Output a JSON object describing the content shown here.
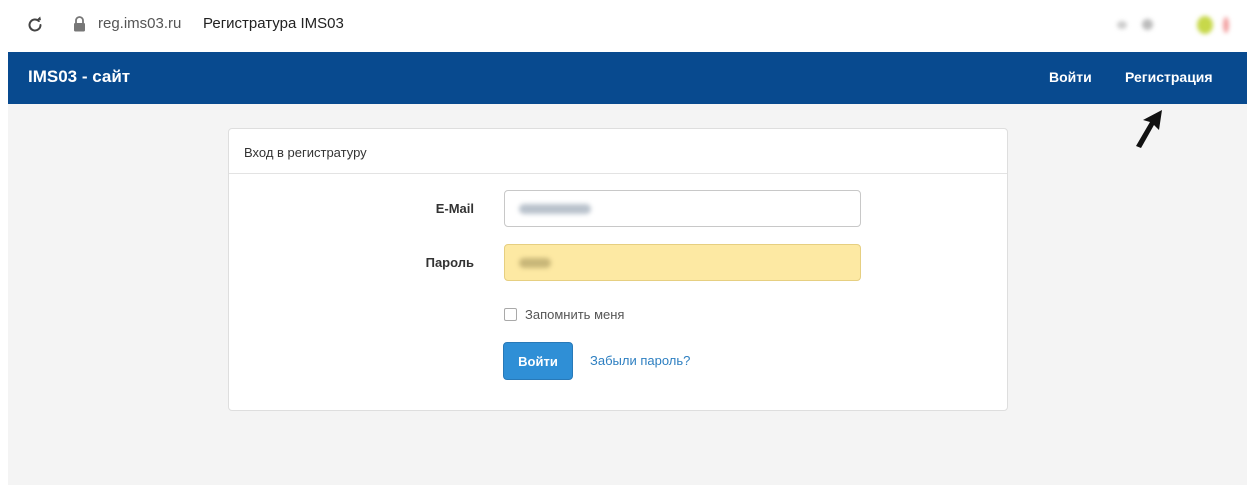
{
  "browser": {
    "url": "reg.ims03.ru",
    "tab_title": "Регистратура IMS03"
  },
  "navbar": {
    "brand": "IMS03 - сайт",
    "login_label": "Войти",
    "register_label": "Регистрация",
    "background_color": "#084a8f"
  },
  "login_card": {
    "header": "Вход в регистратуру",
    "email_label": "E-Mail",
    "password_label": "Пароль",
    "remember_label": "Запомнить меня",
    "remember_checked": false,
    "submit_label": "Войти",
    "forgot_label": "Забыли пароль?"
  },
  "colors": {
    "primary_button": "#2f8fd6",
    "link": "#2d7fc1",
    "autofill_bg": "#fde9a3"
  }
}
